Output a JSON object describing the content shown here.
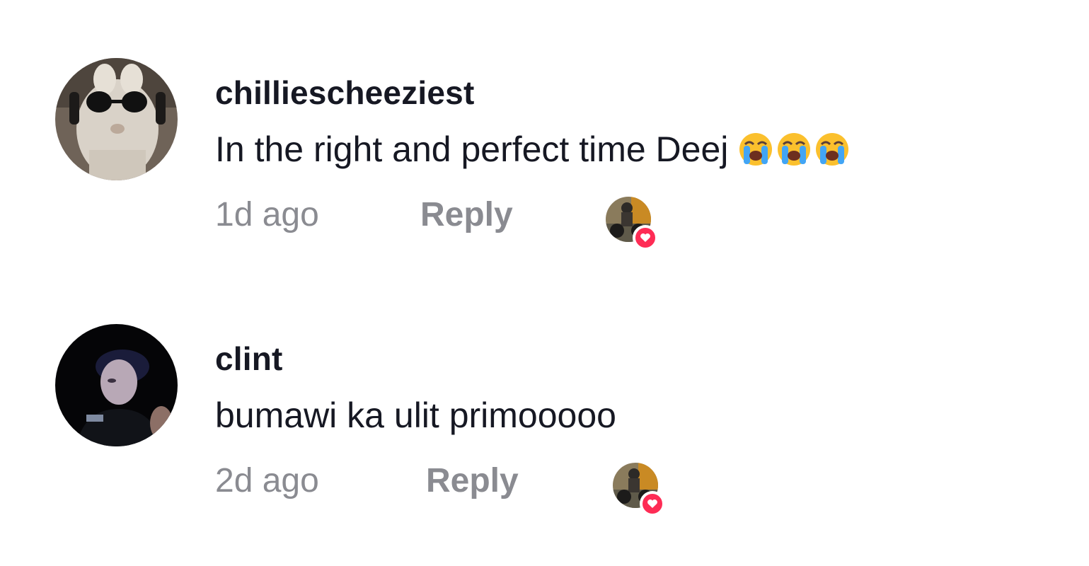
{
  "comments": [
    {
      "username": "chilliescheeziest",
      "text": "In the right and perfect time Deej",
      "emojis": [
        "loudly-crying-face",
        "loudly-crying-face",
        "loudly-crying-face"
      ],
      "time": "1d ago",
      "reply_label": "Reply",
      "liked_by_creator": true
    },
    {
      "username": "clint",
      "text": "bumawi ka ulit primooooo",
      "emojis": [],
      "time": "2d ago",
      "reply_label": "Reply",
      "liked_by_creator": true
    }
  ],
  "colors": {
    "text_primary": "#161823",
    "text_secondary": "#8a8b91",
    "heart_badge": "#fe2c55",
    "background": "#ffffff"
  },
  "icons": {
    "creator_like_badge": "heart-icon",
    "emoji": "loudly-crying-face-emoji"
  }
}
